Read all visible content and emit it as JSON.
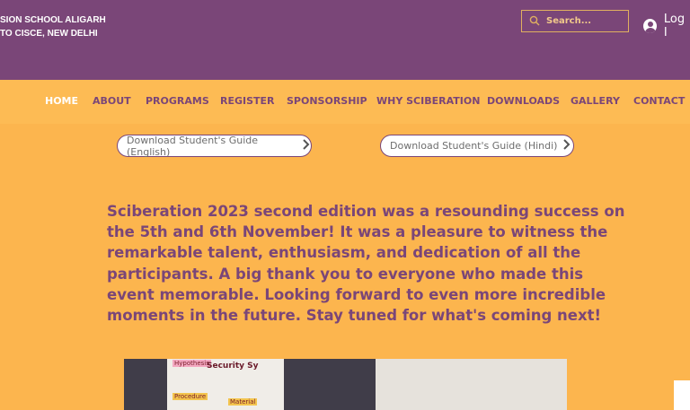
{
  "header": {
    "school_line1": "SION SCHOOL ALIGARH",
    "school_line2": "TO CISCE, NEW DELHI",
    "search_placeholder": "Search...",
    "login_label": "Log I"
  },
  "nav": {
    "items": [
      "HOME",
      "ABOUT",
      "PROGRAMS",
      "REGISTER",
      "SPONSORSHIP",
      "WHY SCIBERATION",
      "DOWNLOADS",
      "GALLERY",
      "CONTACT"
    ],
    "active": "HOME"
  },
  "downloads": {
    "english_label": "Download Student's Guide (English)",
    "hindi_label": "Download Student's Guide (Hindi)"
  },
  "announcement": "Sciberation 2023 second edition was a resounding success on the 5th and 6th November! It was a pleasure to witness the remarkable talent, enthusiasm, and dedication of all the participants. A big thank you to everyone who made this event memorable. Looking forward to even more incredible moments in the future. Stay tuned for what's coming next!",
  "photo": {
    "board_words": [
      "Hypothesis",
      "Security Sy",
      "Procedure",
      "Material"
    ]
  },
  "colors": {
    "header_bg": "#7a4678",
    "page_bg": "#fcb54e",
    "accent": "#7a4678"
  },
  "icons": {
    "search": "search-icon",
    "avatar": "user-avatar-icon",
    "chevron": "chevron-right-icon"
  }
}
